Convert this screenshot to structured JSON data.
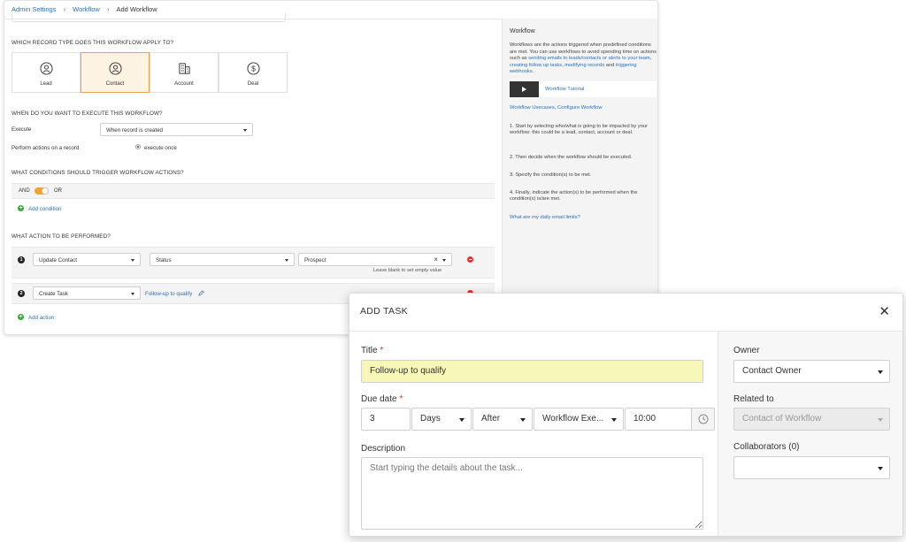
{
  "breadcrumb": {
    "items": [
      "Admin Settings",
      "Workflow",
      "Add Workflow"
    ]
  },
  "record_type": {
    "heading": "WHICH RECORD TYPE DOES THIS WORKFLOW APPLY TO?",
    "options": [
      {
        "label": "Lead",
        "icon": "lead-icon",
        "selected": false
      },
      {
        "label": "Contact",
        "icon": "contact-icon",
        "selected": true
      },
      {
        "label": "Account",
        "icon": "building-icon",
        "selected": false
      },
      {
        "label": "Deal",
        "icon": "dollar-icon",
        "selected": false
      }
    ]
  },
  "execute": {
    "heading": "WHEN DO YOU WANT TO EXECUTE THIS WORKFLOW?",
    "execute_label": "Execute",
    "execute_value": "When record is created",
    "perform_label": "Perform actions on a record",
    "perform_value": "execute once"
  },
  "conditions": {
    "heading": "WHAT CONDITIONS SHOULD TRIGGER WORKFLOW ACTIONS?",
    "and_label": "AND",
    "or_label": "OR",
    "add_label": "Add condition"
  },
  "actions": {
    "heading": "WHAT ACTION TO BE PERFORMED?",
    "rows": [
      {
        "number": "1",
        "action": "Update Contact",
        "field": "Status",
        "value": "Prospect",
        "hint": "Leave blank to set empty value"
      },
      {
        "number": "2",
        "action": "Create Task",
        "task_link": "Follow-up to qualify"
      }
    ],
    "add_label": "Add action"
  },
  "help": {
    "title": "Workflow",
    "intro_plain_1": "Workflows are the actions triggered when predefined conditions are met. You can use workflows to avoid spending time on actions such as ",
    "intro_link_1": "sending emails to leads/contacts or alerts to your team",
    "intro_sep_1": ", ",
    "intro_link_2": "creating follow up tasks",
    "intro_sep_2": ", ",
    "intro_link_3": "modifying records",
    "intro_sep_3": " and ",
    "intro_link_4": "triggering webhooks",
    "intro_end": ".",
    "video_label": "Workflow Tutorial",
    "usecases_link": "Workflow Usecases",
    "usecases_sep": ", ",
    "configure_link": "Configure Workflow",
    "steps": [
      "1. Start by selecting who/what is going to be impacted by your workflow: this could be a lead, contact, account or deal.",
      "2. Then decide when the workflow should be executed.",
      "3. Specify the condition(s) to be met.",
      "4. Finally, indicate the action(s) to be performed when the condition(s) is/are met."
    ],
    "email_limits_link": "What are my daily email limits?"
  },
  "modal": {
    "title": "ADD TASK",
    "title_label": "Title",
    "title_value": "Follow-up to qualify",
    "due_label": "Due date",
    "due_amount": "3",
    "due_unit": "Days",
    "due_relation": "After",
    "due_reference": "Workflow Exe...",
    "due_time": "10:00",
    "description_label": "Description",
    "description_placeholder": "Start typing the details about the task...",
    "owner_label": "Owner",
    "owner_value": "Contact Owner",
    "related_label": "Related to",
    "related_value": "Contact of Workflow",
    "collaborators_label": "Collaborators (0)",
    "collaborators_value": "",
    "colors": {
      "highlight": "#f7f7b7",
      "accent": "#f0a42b",
      "required": "#d0342c"
    }
  }
}
